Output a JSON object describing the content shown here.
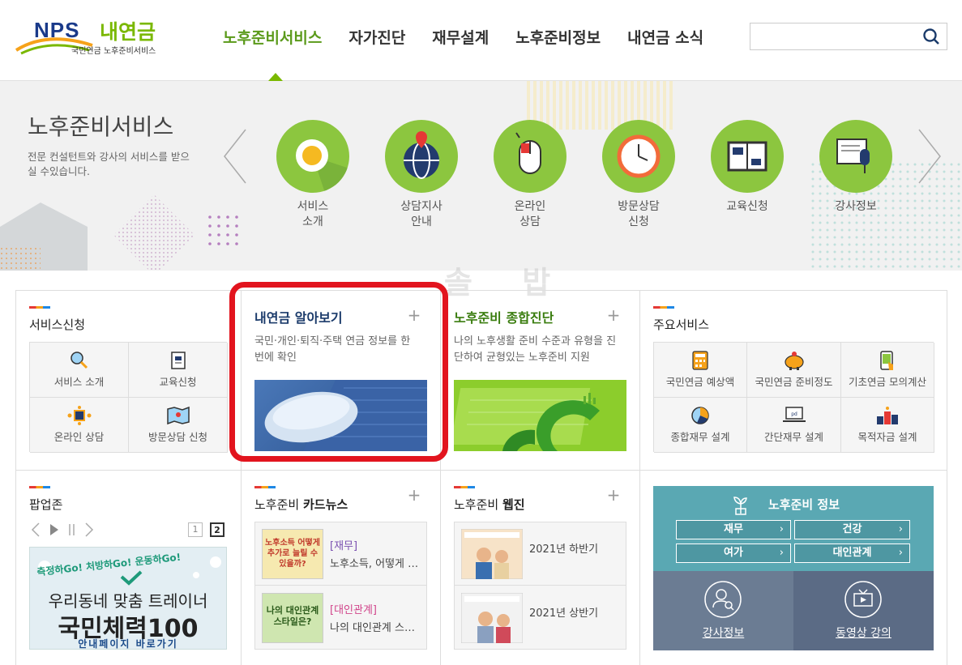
{
  "header": {
    "logo": {
      "mark": "NPS",
      "brand": "내연금",
      "sub": "국민연금 노후준비서비스"
    },
    "nav": [
      "노후준비서비스",
      "자가진단",
      "재무설계",
      "노후준비정보",
      "내연금 소식"
    ],
    "search": {
      "placeholder": ""
    }
  },
  "banner": {
    "title": "노후준비서비스",
    "desc": "전문 컨설턴트와 강사의 서비스를 받으실 수있습니다.",
    "items": [
      {
        "label": "서비스\n소개",
        "icon": "egg-icon"
      },
      {
        "label": "상담지사\n안내",
        "icon": "globe-pin-icon"
      },
      {
        "label": "온라인\n상담",
        "icon": "mouse-icon"
      },
      {
        "label": "방문상담\n신청",
        "icon": "clock-icon"
      },
      {
        "label": "교육신청",
        "icon": "book-icon"
      },
      {
        "label": "강사정보",
        "icon": "microphone-icon"
      }
    ]
  },
  "watermark": "솔 밥",
  "service_apply": {
    "title": "서비스신청",
    "cells": [
      "서비스 소개",
      "교육신청",
      "온라인 상담",
      "방문상담 신청"
    ]
  },
  "my_pension": {
    "title": "내연금 알아보기",
    "desc": "국민·개인·퇴직·주택 연금 정보를 한 번에 확인"
  },
  "diagnosis": {
    "title": "노후준비 종합진단",
    "desc": "나의 노후생활 준비 수준과 유형을 진단하여 균형있는 노후준비 지원"
  },
  "main_services": {
    "title": "주요서비스",
    "cells": [
      "국민연금 예상액",
      "국민연금 준비정도",
      "기초연금 모의계산",
      "종합재무 설계",
      "간단재무 설계",
      "목적자금 설계"
    ]
  },
  "popup": {
    "title": "팝업존",
    "pages": [
      "1",
      "2"
    ],
    "banner": {
      "top": "측정하Go! 처방하Go! 운동하Go!",
      "line1": "우리동네 맞춤 트레이너",
      "line2": "국민체력100",
      "line3": "안내페이지 바로가기"
    }
  },
  "cardnews": {
    "title_pre": "노후준비 ",
    "title_bold": "카드뉴스",
    "items": [
      {
        "cat": "[재무]",
        "text": "노후소득, 어떻게 추가로 늘릴 수 있을까?",
        "thumb": "노후소득 어떻게 추가로 늘릴 수 있을까?"
      },
      {
        "cat": "[대인관계]",
        "text": "나의 대인관계 스타일은?",
        "thumb": "나의 대인관계 스타일은?"
      }
    ]
  },
  "webzine": {
    "title_pre": "노후준비 ",
    "title_bold": "웹진",
    "items": [
      {
        "text": "2021년 하반기"
      },
      {
        "text": "2021년 상반기"
      }
    ]
  },
  "info": {
    "title": "노후준비 정보",
    "buttons": [
      "재무",
      "건강",
      "여가",
      "대인관계"
    ],
    "bottom": [
      "강사정보",
      "동영상 강의"
    ]
  },
  "colors": {
    "accent": "#7ab800",
    "nav_active": "#5b9a1b",
    "circle": "#8cc63f",
    "frame": "#e2141e",
    "teal": "#5aa8b3"
  }
}
